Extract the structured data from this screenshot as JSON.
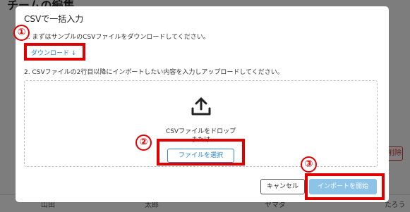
{
  "background": {
    "page_title": "チームの編集",
    "delete_label": "削除",
    "row": {
      "col1": "山田",
      "col2": "太郎",
      "col3": "ヤマダ",
      "col4": "たろう"
    }
  },
  "modal": {
    "title": "CSVで一括入力",
    "step1_text": "1. まずはサンプルのCSVファイルをダウンロードしてください。",
    "download_link": "ダウンロード",
    "download_arrow": "↓",
    "step2_text": "2. CSVファイルの2行目以降にインポートしたい内容を入力しアップロードしてください。",
    "dropzone": {
      "icon": "upload-icon",
      "text_line1": "CSVファイルをドロップ",
      "text_line2": "または",
      "select_button": "ファイルを選択"
    },
    "cancel_button": "キャンセル",
    "import_button": "インポートを開始"
  },
  "annotations": {
    "color": "#e00000",
    "markers": [
      "①",
      "②",
      "③"
    ]
  },
  "colors": {
    "link": "#2f86c9",
    "primary_disabled": "#8ec3e8"
  }
}
